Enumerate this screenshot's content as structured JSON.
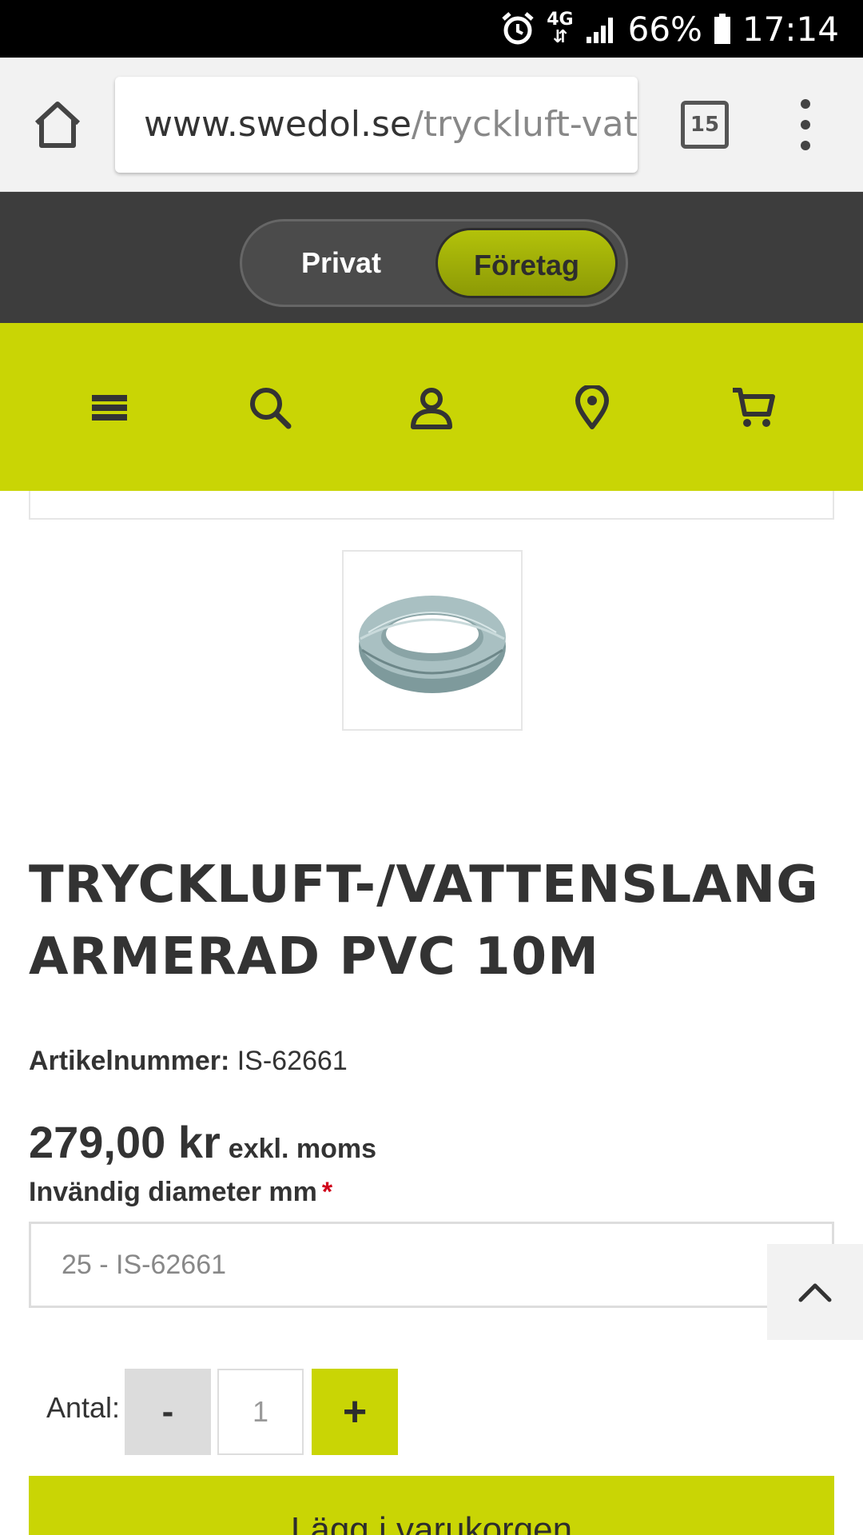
{
  "status_bar": {
    "network": "4G",
    "battery": "66%",
    "time": "17:14"
  },
  "browser": {
    "url_host": "www.swedol.se",
    "url_path": "/tryckluft-vattenslang",
    "tab_count": "15"
  },
  "customer_toggle": {
    "privat": "Privat",
    "foretag": "Företag",
    "selected": "Företag"
  },
  "nav": {
    "icons": [
      "menu-icon",
      "search-icon",
      "user-icon",
      "location-icon",
      "cart-icon"
    ]
  },
  "product": {
    "title": "TRYCKLUFT-/VATTENSLANG ARMERAD PVC 10M",
    "artnr_label": "Artikelnummer:",
    "artnr_value": "IS-62661",
    "price": "279,00 kr",
    "price_suffix": "exkl. moms",
    "diameter_label": "Invändig diameter mm",
    "required_mark": "*",
    "diameter_selected": "25 - IS-62661"
  },
  "quantity": {
    "label": "Antal:",
    "minus": "-",
    "value": "1",
    "plus": "+"
  },
  "add_to_cart": "Lägg i varukorgen",
  "colors": {
    "brand_green": "#c9d505",
    "dark_bar": "#3d3d3d",
    "required": "#d0021b"
  }
}
